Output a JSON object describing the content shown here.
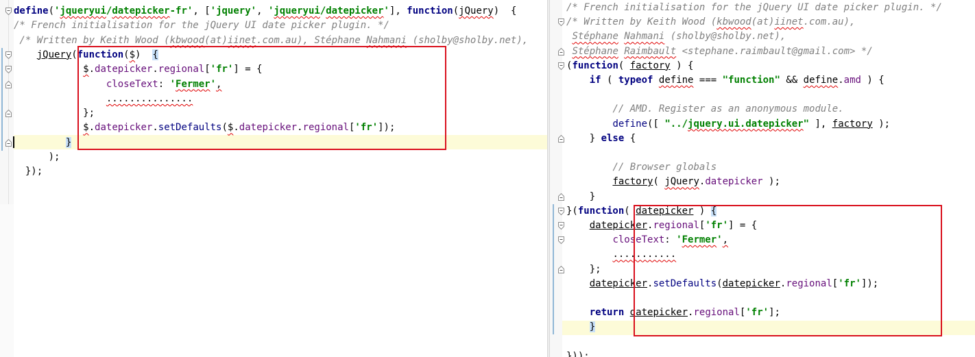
{
  "left_editor": {
    "lines": [
      [
        {
          "t": "define",
          "c": "kw"
        },
        {
          "t": "(",
          "c": ""
        },
        {
          "t": "'",
          "c": "str"
        },
        {
          "t": "jqueryui",
          "c": "str ul"
        },
        {
          "t": "/",
          "c": "str"
        },
        {
          "t": "datepicker",
          "c": "str ul"
        },
        {
          "t": "-fr'",
          "c": "str"
        },
        {
          "t": ", [",
          "c": ""
        },
        {
          "t": "'jquery'",
          "c": "str"
        },
        {
          "t": ", ",
          "c": ""
        },
        {
          "t": "'",
          "c": "str"
        },
        {
          "t": "jqueryui",
          "c": "str ul"
        },
        {
          "t": "/",
          "c": "str"
        },
        {
          "t": "datepicker",
          "c": "str ul"
        },
        {
          "t": "'",
          "c": "str"
        },
        {
          "t": "], ",
          "c": ""
        },
        {
          "t": "function",
          "c": "kw"
        },
        {
          "t": "(",
          "c": ""
        },
        {
          "t": "jQuery",
          "c": "ul"
        },
        {
          "t": ")  {",
          "c": ""
        }
      ],
      [
        {
          "t": "/* French initialisation for the jQuery UI date picker plugin. */",
          "c": "cmt"
        }
      ],
      [
        {
          "t": " /* Written by Keith Wood (",
          "c": "cmt"
        },
        {
          "t": "kbwood",
          "c": "cmt ul"
        },
        {
          "t": "(at)",
          "c": "cmt"
        },
        {
          "t": "iinet",
          "c": "cmt ul"
        },
        {
          "t": ".com.au), Stéphane ",
          "c": "cmt"
        },
        {
          "t": "Nahmani",
          "c": "cmt ul"
        },
        {
          "t": " (sholby@sholby.net),",
          "c": "cmt"
        }
      ],
      [
        {
          "t": "    ",
          "c": ""
        },
        {
          "t": "jQuery",
          "c": "uls"
        },
        {
          "t": "(",
          "c": ""
        },
        {
          "t": "function",
          "c": "kw"
        },
        {
          "t": "(",
          "c": ""
        },
        {
          "t": "$",
          "c": "ul"
        },
        {
          "t": ")  ",
          "c": ""
        },
        {
          "t": "{",
          "c": "brace-hl"
        }
      ],
      [
        {
          "t": "            ",
          "c": ""
        },
        {
          "t": "$",
          "c": "ul"
        },
        {
          "t": ".",
          "c": ""
        },
        {
          "t": "datepicker",
          "c": "prop"
        },
        {
          "t": ".",
          "c": ""
        },
        {
          "t": "regional",
          "c": "prop"
        },
        {
          "t": "[",
          "c": ""
        },
        {
          "t": "'fr'",
          "c": "str"
        },
        {
          "t": "] = {",
          "c": ""
        }
      ],
      [
        {
          "t": "                ",
          "c": ""
        },
        {
          "t": "closeText",
          "c": "prop"
        },
        {
          "t": ": ",
          "c": ""
        },
        {
          "t": "'",
          "c": "str"
        },
        {
          "t": "Fermer",
          "c": "str ul"
        },
        {
          "t": "'",
          "c": "str"
        },
        {
          "t": ",",
          "c": "ul"
        }
      ],
      [
        {
          "t": "                ",
          "c": ""
        },
        {
          "t": "...............",
          "c": "ul"
        }
      ],
      [
        {
          "t": "            };",
          "c": ""
        }
      ],
      [
        {
          "t": "            ",
          "c": ""
        },
        {
          "t": "$",
          "c": "ul"
        },
        {
          "t": ".",
          "c": ""
        },
        {
          "t": "datepicker",
          "c": "prop"
        },
        {
          "t": ".",
          "c": ""
        },
        {
          "t": "setDefaults",
          "c": "fn"
        },
        {
          "t": "(",
          "c": ""
        },
        {
          "t": "$",
          "c": "ul"
        },
        {
          "t": ".",
          "c": ""
        },
        {
          "t": "datepicker",
          "c": "prop"
        },
        {
          "t": ".",
          "c": ""
        },
        {
          "t": "regional",
          "c": "prop"
        },
        {
          "t": "[",
          "c": ""
        },
        {
          "t": "'fr'",
          "c": "str"
        },
        {
          "t": "]);",
          "c": ""
        }
      ],
      [
        {
          "t": "         ",
          "c": ""
        },
        {
          "t": "}",
          "c": "brace-hl"
        }
      ],
      [
        {
          "t": "      );",
          "c": ""
        }
      ],
      [
        {
          "t": "  });",
          "c": ""
        }
      ]
    ]
  },
  "right_editor": {
    "lines": [
      [
        {
          "t": "/* French initialisation for the jQuery UI date picker plugin. */",
          "c": "cmt"
        }
      ],
      [
        {
          "t": "/* Written by Keith Wood (",
          "c": "cmt"
        },
        {
          "t": "kbwood",
          "c": "cmt ul"
        },
        {
          "t": "(at)",
          "c": "cmt"
        },
        {
          "t": "iinet",
          "c": "cmt ul"
        },
        {
          "t": ".com.au),",
          "c": "cmt"
        }
      ],
      [
        {
          "t": " ",
          "c": "cmt"
        },
        {
          "t": "Stéphane",
          "c": "cmt ul"
        },
        {
          "t": " ",
          "c": "cmt"
        },
        {
          "t": "Nahmani",
          "c": "cmt ul"
        },
        {
          "t": " (sholby@sholby.net),",
          "c": "cmt"
        }
      ],
      [
        {
          "t": " ",
          "c": "cmt"
        },
        {
          "t": "Stéphane",
          "c": "cmt ul"
        },
        {
          "t": " ",
          "c": "cmt"
        },
        {
          "t": "Raimbault",
          "c": "cmt ul"
        },
        {
          "t": " <stephane.raimbault@gmail.com> */",
          "c": "cmt"
        }
      ],
      [
        {
          "t": "(",
          "c": ""
        },
        {
          "t": "function",
          "c": "kw"
        },
        {
          "t": "( ",
          "c": ""
        },
        {
          "t": "factory",
          "c": "uls"
        },
        {
          "t": " ) {",
          "c": ""
        }
      ],
      [
        {
          "t": "    ",
          "c": ""
        },
        {
          "t": "if",
          "c": "kw"
        },
        {
          "t": " ( ",
          "c": ""
        },
        {
          "t": "typeof",
          "c": "kw"
        },
        {
          "t": " ",
          "c": ""
        },
        {
          "t": "define",
          "c": "ul"
        },
        {
          "t": " === ",
          "c": ""
        },
        {
          "t": "\"function\"",
          "c": "str"
        },
        {
          "t": " && ",
          "c": ""
        },
        {
          "t": "define",
          "c": "ul"
        },
        {
          "t": ".",
          "c": ""
        },
        {
          "t": "amd",
          "c": "prop"
        },
        {
          "t": " ) {",
          "c": ""
        }
      ],
      [
        {
          "t": "",
          "c": ""
        }
      ],
      [
        {
          "t": "        ",
          "c": ""
        },
        {
          "t": "// AMD. Register as an anonymous module.",
          "c": "cmt"
        }
      ],
      [
        {
          "t": "        ",
          "c": ""
        },
        {
          "t": "define",
          "c": "fn"
        },
        {
          "t": "([ ",
          "c": ""
        },
        {
          "t": "\"../",
          "c": "str"
        },
        {
          "t": "jquery.ui.datepicker",
          "c": "str ul"
        },
        {
          "t": "\"",
          "c": "str"
        },
        {
          "t": " ], ",
          "c": ""
        },
        {
          "t": "factory",
          "c": "uls"
        },
        {
          "t": " );",
          "c": ""
        }
      ],
      [
        {
          "t": "    } ",
          "c": ""
        },
        {
          "t": "else",
          "c": "kw"
        },
        {
          "t": " {",
          "c": ""
        }
      ],
      [
        {
          "t": "",
          "c": ""
        }
      ],
      [
        {
          "t": "        ",
          "c": ""
        },
        {
          "t": "// Browser globals",
          "c": "cmt"
        }
      ],
      [
        {
          "t": "        ",
          "c": ""
        },
        {
          "t": "factory",
          "c": "uls"
        },
        {
          "t": "( ",
          "c": ""
        },
        {
          "t": "jQuery",
          "c": "ul"
        },
        {
          "t": ".",
          "c": ""
        },
        {
          "t": "datepicker",
          "c": "prop"
        },
        {
          "t": " );",
          "c": ""
        }
      ],
      [
        {
          "t": "    }",
          "c": ""
        }
      ],
      [
        {
          "t": "}(",
          "c": ""
        },
        {
          "t": "function",
          "c": "kw"
        },
        {
          "t": "( ",
          "c": ""
        },
        {
          "t": "datepicker",
          "c": "uls"
        },
        {
          "t": " ) ",
          "c": ""
        },
        {
          "t": "{",
          "c": "brace-hl"
        }
      ],
      [
        {
          "t": "    ",
          "c": ""
        },
        {
          "t": "datepicker",
          "c": "uls"
        },
        {
          "t": ".",
          "c": ""
        },
        {
          "t": "regional",
          "c": "prop"
        },
        {
          "t": "[",
          "c": ""
        },
        {
          "t": "'fr'",
          "c": "str"
        },
        {
          "t": "] = {",
          "c": ""
        }
      ],
      [
        {
          "t": "        ",
          "c": ""
        },
        {
          "t": "closeText",
          "c": "prop"
        },
        {
          "t": ": ",
          "c": ""
        },
        {
          "t": "'",
          "c": "str"
        },
        {
          "t": "Fermer",
          "c": "str ul"
        },
        {
          "t": "'",
          "c": "str"
        },
        {
          "t": ",",
          "c": "ul"
        }
      ],
      [
        {
          "t": "        ",
          "c": ""
        },
        {
          "t": "...........",
          "c": "ul"
        }
      ],
      [
        {
          "t": "    };",
          "c": ""
        }
      ],
      [
        {
          "t": "    ",
          "c": ""
        },
        {
          "t": "datepicker",
          "c": "uls"
        },
        {
          "t": ".",
          "c": ""
        },
        {
          "t": "setDefaults",
          "c": "fn"
        },
        {
          "t": "(",
          "c": ""
        },
        {
          "t": "datepicker",
          "c": "uls"
        },
        {
          "t": ".",
          "c": ""
        },
        {
          "t": "regional",
          "c": "prop"
        },
        {
          "t": "[",
          "c": ""
        },
        {
          "t": "'fr'",
          "c": "str"
        },
        {
          "t": "]);",
          "c": ""
        }
      ],
      [
        {
          "t": "",
          "c": ""
        }
      ],
      [
        {
          "t": "    ",
          "c": ""
        },
        {
          "t": "return",
          "c": "kw"
        },
        {
          "t": " ",
          "c": ""
        },
        {
          "t": "datepicker",
          "c": "uls"
        },
        {
          "t": ".",
          "c": ""
        },
        {
          "t": "regional",
          "c": "prop"
        },
        {
          "t": "[",
          "c": ""
        },
        {
          "t": "'fr'",
          "c": "str"
        },
        {
          "t": "];",
          "c": ""
        }
      ],
      [
        {
          "t": "    ",
          "c": ""
        },
        {
          "t": "}",
          "c": "brace-hl"
        }
      ],
      [
        {
          "t": "",
          "c": ""
        }
      ],
      [
        {
          "t": "}));",
          "c": ""
        }
      ]
    ]
  },
  "colors": {
    "annotation_box": "#d90f1c",
    "current_line": "#fdfbd8",
    "keyword": "#000080",
    "string": "#008000",
    "comment": "#808080",
    "property": "#660e7a"
  }
}
